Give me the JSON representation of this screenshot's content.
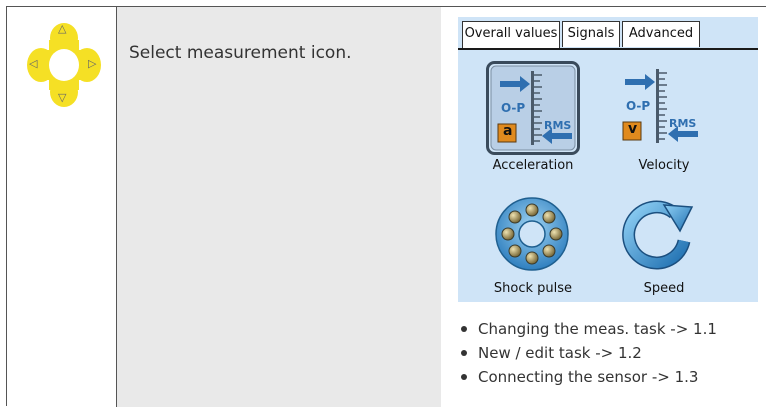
{
  "navigation": {
    "up_glyph": "△",
    "down_glyph": "▽",
    "left_glyph": "◁",
    "right_glyph": "▷",
    "pad_color": "#f5e025",
    "glyph_color": "#666666"
  },
  "instruction": "Select measurement icon.",
  "screen": {
    "background": "#cfe4f7",
    "tabs": [
      {
        "label": "Overall values",
        "active": true
      },
      {
        "label": "Signals",
        "active": false
      },
      {
        "label": "Advanced",
        "active": false
      }
    ],
    "tiles": [
      {
        "label": "Acceleration",
        "icon": "acceleration-icon",
        "unit_letter": "a",
        "rms_label": "RMS",
        "op_label": "O-P",
        "selected": true
      },
      {
        "label": "Velocity",
        "icon": "velocity-icon",
        "unit_letter": "v",
        "rms_label": "RMS",
        "op_label": "O-P",
        "selected": false
      },
      {
        "label": "Shock pulse",
        "icon": "bearing-icon",
        "selected": false
      },
      {
        "label": "Speed",
        "icon": "rotation-arrow-icon",
        "selected": false
      }
    ]
  },
  "related_links": [
    "Changing the meas. task -> 1.1",
    "New / edit task -> 1.2",
    "Connecting the sensor -> 1.3"
  ]
}
